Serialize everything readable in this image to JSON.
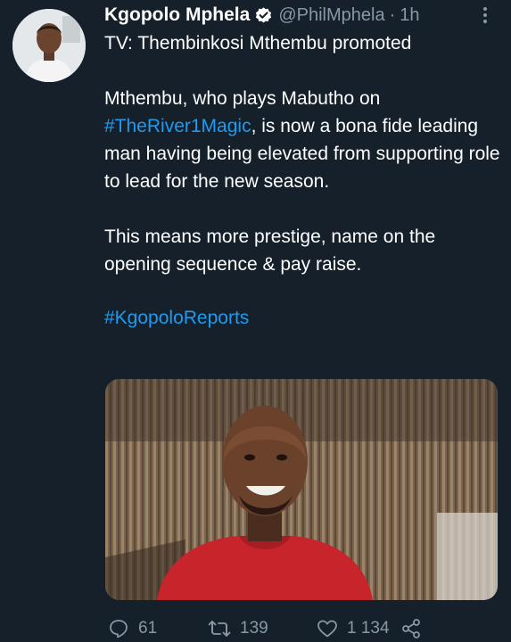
{
  "author": {
    "name": "Kgopolo Mphela",
    "handle": "@PhilMphela",
    "separator": "·",
    "time": "1h"
  },
  "tweet": {
    "line1": "TV: Thembinkosi Mthembu promoted",
    "para2_before": "Mthembu, who plays Mabutho on ",
    "para2_hashtag": "#TheRiver1Magic",
    "para2_after": ", is now a bona fide leading man having being elevated from supporting role to lead for the new season.",
    "para3": "This means more prestige, name on the opening sequence & pay raise.",
    "hashtag": "#KgopoloReports"
  },
  "stats": {
    "replies": "61",
    "retweets": "139",
    "likes": "1 134"
  },
  "icons": {
    "verified": "verified-badge-icon",
    "more": "more-options-icon",
    "reply": "reply-icon",
    "retweet": "retweet-icon",
    "like": "heart-icon",
    "share": "share-icon"
  },
  "colors": {
    "background": "#15202b",
    "text": "#ffffff",
    "secondary": "#8899a6",
    "link": "#1d9bf0"
  }
}
